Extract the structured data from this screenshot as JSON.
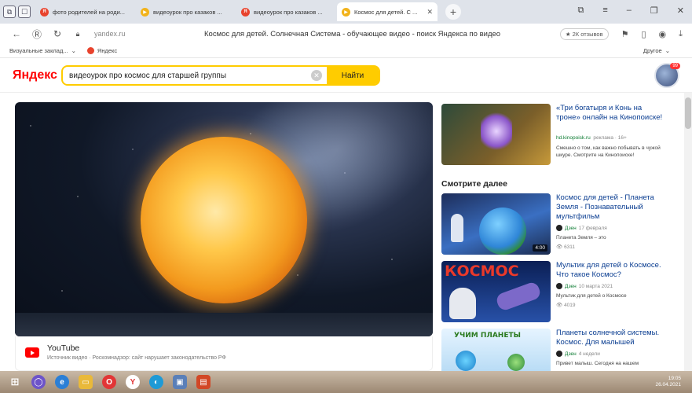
{
  "tabs": [
    {
      "title": "фото родителей на роди...",
      "color": "#e8432d"
    },
    {
      "title": "видеоурок про казаков ...",
      "color": "#f2b31b"
    },
    {
      "title": "видеоурок про казаков ...",
      "color": "#e8432d"
    },
    {
      "title": "Космос для детей. С ...",
      "color": "#f2b31b",
      "active": true
    }
  ],
  "addressbar": {
    "host": "yandex.ru",
    "title": "Космос для детей. Солнечная Система - обучающее видео - поиск Яндекса по видео",
    "reviews": "★ 2К отзывов"
  },
  "bookmarks": {
    "visual": "Визуальные заклад...",
    "yandex": "Яндекс",
    "other": "Другое"
  },
  "search": {
    "logo": "Яндекс",
    "query": "видеоурок про космос для старшей группы",
    "button": "Найти",
    "badge": "99"
  },
  "player": {
    "source": "YouTube",
    "note": "Источник видео · Роскомнадзор: сайт нарушает законодательство РФ"
  },
  "ad": {
    "title": "«Три богатыря и Конь на троне» онлайн на Кинопоиске!",
    "domain": "hd.kinopoisk.ru",
    "label": "реклама · 16+",
    "desc": "Смешно о том, как важно побывать в чужой шкуре. Смотрите на Кинопоиске!"
  },
  "watch_next": {
    "header": "Смотрите далее",
    "items": [
      {
        "title": "Космос для детей - Планета Земля - Познавательный мультфильм",
        "channel": "Дзен",
        "date": "17 февраля",
        "desc": "Планета Земля – это",
        "views": "6311",
        "duration": "4:00"
      },
      {
        "title": "Мультик для детей о Космосе. Что такое Космос?",
        "channel": "Дзен",
        "date": "10 марта 2021",
        "desc": "Мультик для детей о Космосе",
        "views": "4019",
        "thumb_text": "КОСМОС"
      },
      {
        "title": "Планеты солнечной системы. Космос. Для малышей",
        "channel": "Дзен",
        "date": "4 недели",
        "desc": "Привет малыш. Сегодня на нашем",
        "thumb_text": "УЧИМ ПЛАНЕТЫ"
      }
    ]
  },
  "tray": {
    "time": "19:05",
    "date": "26.04.2021"
  }
}
